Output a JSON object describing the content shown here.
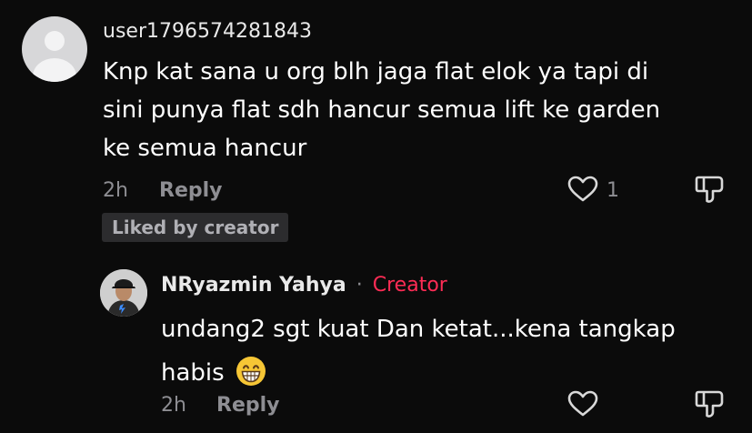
{
  "comment": {
    "username": "user1796574281843",
    "text": "Knp kat sana u org blh jaga flat elok ya tapi di sini punya flat sdh hancur semua lift ke garden ke semua hancur",
    "time": "2h",
    "reply_label": "Reply",
    "like_count": "1",
    "badge": "Liked by creator",
    "avatar_icon": "default-user-avatar"
  },
  "reply": {
    "author": "NRyazmin Yahya",
    "separator": "·",
    "tag": "Creator",
    "text": "undang2 sgt kuat Dan ketat...kena tangkap habis",
    "emoji": "grinning-face-emoji",
    "time": "2h",
    "reply_label": "Reply"
  },
  "colors": {
    "background": "#0b0b0b",
    "muted": "#8e8e93",
    "creator": "#fe2c55",
    "badge_bg": "#2c2c2e"
  }
}
